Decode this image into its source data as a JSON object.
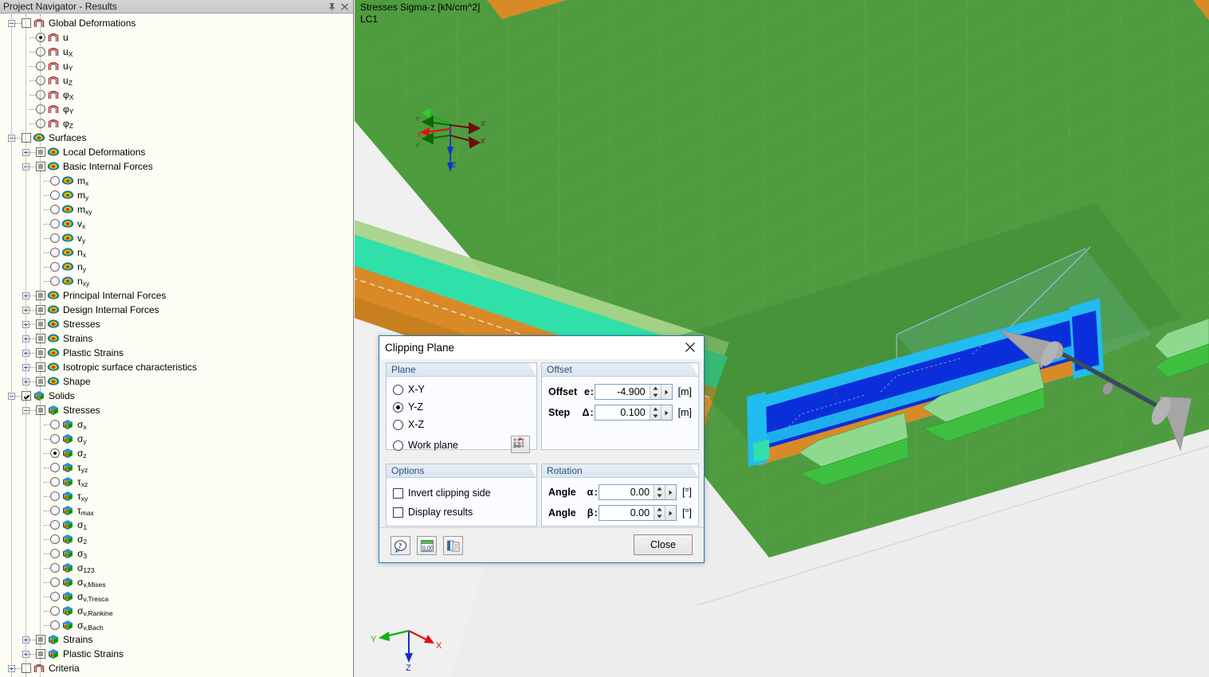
{
  "navigator": {
    "title": "Project Navigator - Results",
    "pin_icon": "pin-icon",
    "close_icon": "close-icon",
    "tree": [
      {
        "id": "global-deformations",
        "label": "Global Deformations",
        "depth": 0,
        "ctrl": "checkbox",
        "state": "unchecked",
        "exp": "minus",
        "icon": "member-icon"
      },
      {
        "id": "u",
        "label": "u",
        "depth": 1,
        "ctrl": "radio",
        "state": "on",
        "exp": "none",
        "icon": "member-icon"
      },
      {
        "id": "ux",
        "label": "u",
        "sub": "X",
        "depth": 1,
        "ctrl": "radio",
        "state": "off",
        "exp": "none",
        "icon": "member-icon"
      },
      {
        "id": "uy",
        "label": "u",
        "sub": "Y",
        "depth": 1,
        "ctrl": "radio",
        "state": "off",
        "exp": "none",
        "icon": "member-icon"
      },
      {
        "id": "uz",
        "label": "u",
        "sub": "Z",
        "depth": 1,
        "ctrl": "radio",
        "state": "off",
        "exp": "none",
        "icon": "member-icon"
      },
      {
        "id": "phix",
        "label": "φ",
        "sub": "X",
        "depth": 1,
        "ctrl": "radio",
        "state": "off",
        "exp": "none",
        "icon": "member-icon"
      },
      {
        "id": "phiy",
        "label": "φ",
        "sub": "Y",
        "depth": 1,
        "ctrl": "radio",
        "state": "off",
        "exp": "none",
        "icon": "member-icon"
      },
      {
        "id": "phiz",
        "label": "φ",
        "sub": "Z",
        "depth": 1,
        "ctrl": "radio",
        "state": "off",
        "exp": "none",
        "icon": "member-icon"
      },
      {
        "id": "surfaces",
        "label": "Surfaces",
        "depth": 0,
        "ctrl": "checkbox",
        "state": "unchecked",
        "exp": "minus",
        "icon": "surface-icon"
      },
      {
        "id": "local-deformations",
        "label": "Local Deformations",
        "depth": 1,
        "ctrl": "checkbox",
        "state": "partial",
        "exp": "plus",
        "icon": "surface-icon"
      },
      {
        "id": "basic-internal-forces",
        "label": "Basic Internal Forces",
        "depth": 1,
        "ctrl": "checkbox",
        "state": "partial",
        "exp": "minus",
        "icon": "surface-icon"
      },
      {
        "id": "mx",
        "label": "m",
        "sub": "x",
        "depth": 2,
        "ctrl": "radio",
        "state": "off",
        "exp": "none",
        "icon": "surface-icon"
      },
      {
        "id": "my",
        "label": "m",
        "sub": "y",
        "depth": 2,
        "ctrl": "radio",
        "state": "off",
        "exp": "none",
        "icon": "surface-icon"
      },
      {
        "id": "mxy",
        "label": "m",
        "sub": "xy",
        "depth": 2,
        "ctrl": "radio",
        "state": "off",
        "exp": "none",
        "icon": "surface-icon"
      },
      {
        "id": "vx",
        "label": "v",
        "sub": "x",
        "depth": 2,
        "ctrl": "radio",
        "state": "off",
        "exp": "none",
        "icon": "surface-icon"
      },
      {
        "id": "vy",
        "label": "v",
        "sub": "y",
        "depth": 2,
        "ctrl": "radio",
        "state": "off",
        "exp": "none",
        "icon": "surface-icon"
      },
      {
        "id": "nx",
        "label": "n",
        "sub": "x",
        "depth": 2,
        "ctrl": "radio",
        "state": "off",
        "exp": "none",
        "icon": "surface-icon"
      },
      {
        "id": "ny",
        "label": "n",
        "sub": "y",
        "depth": 2,
        "ctrl": "radio",
        "state": "off",
        "exp": "none",
        "icon": "surface-icon"
      },
      {
        "id": "nxy",
        "label": "n",
        "sub": "xy",
        "depth": 2,
        "ctrl": "radio",
        "state": "off",
        "exp": "none",
        "icon": "surface-icon"
      },
      {
        "id": "principal-internal-forces",
        "label": "Principal Internal Forces",
        "depth": 1,
        "ctrl": "checkbox",
        "state": "partial",
        "exp": "plus",
        "icon": "surface-icon"
      },
      {
        "id": "design-internal-forces",
        "label": "Design Internal Forces",
        "depth": 1,
        "ctrl": "checkbox",
        "state": "partial",
        "exp": "plus",
        "icon": "surface-icon"
      },
      {
        "id": "surface-stresses",
        "label": "Stresses",
        "depth": 1,
        "ctrl": "checkbox",
        "state": "partial",
        "exp": "plus",
        "icon": "surface-icon"
      },
      {
        "id": "surface-strains",
        "label": "Strains",
        "depth": 1,
        "ctrl": "checkbox",
        "state": "partial",
        "exp": "plus",
        "icon": "surface-icon"
      },
      {
        "id": "surface-plastic-strains",
        "label": "Plastic Strains",
        "depth": 1,
        "ctrl": "checkbox",
        "state": "partial",
        "exp": "plus",
        "icon": "surface-icon"
      },
      {
        "id": "isotropic-surface-characteristics",
        "label": "Isotropic surface characteristics",
        "depth": 1,
        "ctrl": "checkbox",
        "state": "partial",
        "exp": "plus",
        "icon": "surface-icon"
      },
      {
        "id": "shape",
        "label": "Shape",
        "depth": 1,
        "ctrl": "checkbox",
        "state": "partial",
        "exp": "plus",
        "icon": "surface-icon"
      },
      {
        "id": "solids",
        "label": "Solids",
        "depth": 0,
        "ctrl": "checkbox",
        "state": "checked",
        "exp": "minus",
        "icon": "solid-icon"
      },
      {
        "id": "solid-stresses",
        "label": "Stresses",
        "depth": 1,
        "ctrl": "checkbox",
        "state": "partial",
        "exp": "minus",
        "icon": "solid-icon"
      },
      {
        "id": "sigma-x",
        "label": "σ",
        "sub": "x",
        "depth": 2,
        "ctrl": "radio",
        "state": "off",
        "exp": "none",
        "icon": "solid-icon"
      },
      {
        "id": "sigma-y",
        "label": "σ",
        "sub": "y",
        "depth": 2,
        "ctrl": "radio",
        "state": "off",
        "exp": "none",
        "icon": "solid-icon"
      },
      {
        "id": "sigma-z",
        "label": "σ",
        "sub": "z",
        "depth": 2,
        "ctrl": "radio",
        "state": "on",
        "exp": "none",
        "icon": "solid-icon"
      },
      {
        "id": "tau-yz",
        "label": "τ",
        "sub": "yz",
        "depth": 2,
        "ctrl": "radio",
        "state": "off",
        "exp": "none",
        "icon": "solid-icon"
      },
      {
        "id": "tau-xz",
        "label": "τ",
        "sub": "xz",
        "depth": 2,
        "ctrl": "radio",
        "state": "off",
        "exp": "none",
        "icon": "solid-icon"
      },
      {
        "id": "tau-xy",
        "label": "τ",
        "sub": "xy",
        "depth": 2,
        "ctrl": "radio",
        "state": "off",
        "exp": "none",
        "icon": "solid-icon"
      },
      {
        "id": "tau-max",
        "label": "τ",
        "sub": "max",
        "depth": 2,
        "ctrl": "radio",
        "state": "off",
        "exp": "none",
        "icon": "solid-icon"
      },
      {
        "id": "sigma-1",
        "label": "σ",
        "sub": "1",
        "depth": 2,
        "ctrl": "radio",
        "state": "off",
        "exp": "none",
        "icon": "solid-icon"
      },
      {
        "id": "sigma-2",
        "label": "σ",
        "sub": "2",
        "depth": 2,
        "ctrl": "radio",
        "state": "off",
        "exp": "none",
        "icon": "solid-icon"
      },
      {
        "id": "sigma-3",
        "label": "σ",
        "sub": "3",
        "depth": 2,
        "ctrl": "radio",
        "state": "off",
        "exp": "none",
        "icon": "solid-icon"
      },
      {
        "id": "sigma-123",
        "label": "σ",
        "sub": "123",
        "depth": 2,
        "ctrl": "radio",
        "state": "off",
        "exp": "none",
        "icon": "solid-icon"
      },
      {
        "id": "sigma-v-mises",
        "label": "σ",
        "sub": "v,Mises",
        "depth": 2,
        "ctrl": "radio",
        "state": "off",
        "exp": "none",
        "icon": "solid-icon"
      },
      {
        "id": "sigma-v-tresca",
        "label": "σ",
        "sub": "v,Tresca",
        "depth": 2,
        "ctrl": "radio",
        "state": "off",
        "exp": "none",
        "icon": "solid-icon"
      },
      {
        "id": "sigma-v-rankine",
        "label": "σ",
        "sub": "v,Rankine",
        "depth": 2,
        "ctrl": "radio",
        "state": "off",
        "exp": "none",
        "icon": "solid-icon"
      },
      {
        "id": "sigma-v-bach",
        "label": "σ",
        "sub": "v,Bach",
        "depth": 2,
        "ctrl": "radio",
        "state": "off",
        "exp": "none",
        "icon": "solid-icon"
      },
      {
        "id": "solid-strains",
        "label": "Strains",
        "depth": 1,
        "ctrl": "checkbox",
        "state": "partial",
        "exp": "plus",
        "icon": "solid-icon"
      },
      {
        "id": "solid-plastic-strains",
        "label": "Plastic Strains",
        "depth": 1,
        "ctrl": "checkbox",
        "state": "partial",
        "exp": "plus",
        "icon": "solid-icon"
      },
      {
        "id": "criteria",
        "label": "Criteria",
        "depth": 0,
        "ctrl": "checkbox",
        "state": "unchecked",
        "exp": "plus",
        "icon": "member-icon"
      }
    ]
  },
  "viewport": {
    "result_label": "Stresses Sigma-z [kN/cm^2]",
    "load_case": "LC1",
    "axis_triad": {
      "x": "X",
      "y": "Y",
      "z": "Z"
    },
    "colors": {
      "background": "#f0f0f0",
      "slab_green": "#4e9c3f",
      "slab_blue": "#5b8fc9",
      "edge_orange": "#d98a26",
      "clip_blue": "#0b2edb",
      "clip_cyan": "#21bcf0",
      "clip_teal": "#2fe0a8",
      "load_arrow_green": "#3fbf3f",
      "ground": "#ebebeb"
    }
  },
  "dialog": {
    "title": "Clipping Plane",
    "close_icon": "close-icon",
    "plane": {
      "legend": "Plane",
      "options": [
        {
          "id": "x-y",
          "label": "X-Y",
          "selected": false
        },
        {
          "id": "y-z",
          "label": "Y-Z",
          "selected": true
        },
        {
          "id": "x-z",
          "label": "X-Z",
          "selected": false
        },
        {
          "id": "work-plane",
          "label": "Work plane",
          "selected": false
        }
      ],
      "work_plane_button_icon": "grid-3x3-icon"
    },
    "offset": {
      "legend": "Offset",
      "fields": [
        {
          "id": "offset",
          "label": "Offset",
          "symbol": "e",
          "colon": ":",
          "value": "-4.900",
          "unit": "[m]"
        },
        {
          "id": "step",
          "label": "Step",
          "symbol": "Δ",
          "colon": ":",
          "value": "0.100",
          "unit": "[m]"
        }
      ]
    },
    "options": {
      "legend": "Options",
      "items": [
        {
          "id": "invert-clipping-side",
          "label": "Invert clipping side",
          "checked": false
        },
        {
          "id": "display-results",
          "label": "Display results",
          "checked": false
        }
      ]
    },
    "rotation": {
      "legend": "Rotation",
      "fields": [
        {
          "id": "angle-alpha",
          "label": "Angle",
          "symbol": "α",
          "colon": ":",
          "value": "0.00",
          "unit": "[°]"
        },
        {
          "id": "angle-beta",
          "label": "Angle",
          "symbol": "β",
          "colon": ":",
          "value": "0.00",
          "unit": "[°]"
        }
      ]
    },
    "footer": {
      "help_icon": "help-icon",
      "units_icon": "units-icon",
      "report_icon": "report-icon",
      "close_label": "Close"
    }
  }
}
